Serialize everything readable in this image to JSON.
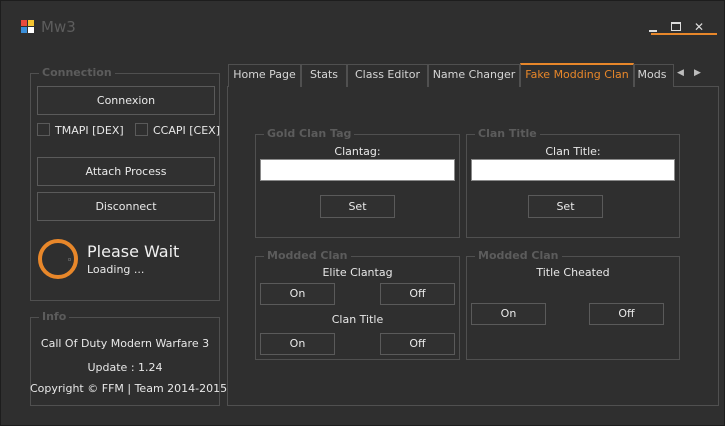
{
  "window": {
    "title": "Mw3",
    "controls": {
      "minimize": "minimize",
      "maximize": "maximize",
      "close": "✕"
    },
    "accent_color": "#e8872a"
  },
  "connection": {
    "title": "Connection",
    "connect_button": "Connexion",
    "tmapi_label": "TMAPI [DEX]",
    "ccapi_label": "CCAPI [CEX]",
    "attach_button": "Attach Process",
    "disconnect_button": "Disconnect",
    "status_title": "Please Wait",
    "status_sub": "Loading ..."
  },
  "info": {
    "title": "Info",
    "game": "Call Of Duty Modern Warfare 3",
    "update": "Update : 1.24",
    "copyright": "Copyright © FFM | Team 2014-2015"
  },
  "tabs": [
    {
      "label": "Home Page",
      "active": false
    },
    {
      "label": "Stats",
      "active": false
    },
    {
      "label": "Class Editor",
      "active": false
    },
    {
      "label": "Name Changer",
      "active": false
    },
    {
      "label": "Fake Modding Clan",
      "active": true
    },
    {
      "label": "Mods",
      "active": false
    }
  ],
  "tab_scroll": {
    "left": "◀",
    "right": "▶"
  },
  "gold_clan_tag": {
    "title": "Gold Clan Tag",
    "field_label": "Clantag:",
    "value": "",
    "set_button": "Set"
  },
  "clan_title": {
    "title": "Clan Title",
    "field_label": "Clan Title:",
    "value": "",
    "set_button": "Set"
  },
  "modded_clan_left": {
    "title": "Modded Clan",
    "elite_label": "Elite Clantag",
    "elite_on": "On",
    "elite_off": "Off",
    "title_label": "Clan Title",
    "title_on": "On",
    "title_off": "Off"
  },
  "modded_clan_right": {
    "title": "Modded Clan",
    "cheated_label": "Title Cheated",
    "on": "On",
    "off": "Off"
  }
}
